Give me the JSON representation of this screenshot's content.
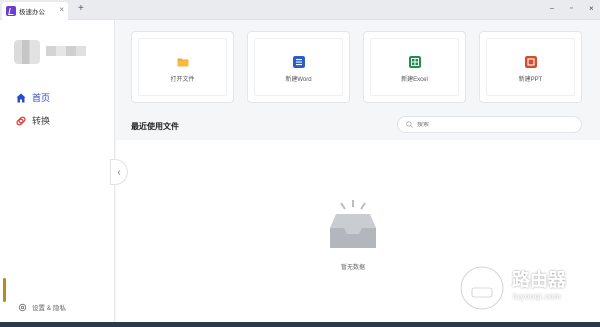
{
  "titlebar": {
    "tab_title": "极速办公",
    "tab_close": "×",
    "new_tab": "+",
    "minimize": "–",
    "maximize": "▫",
    "close": "×"
  },
  "sidebar": {
    "items": [
      {
        "label": "首页",
        "icon": "home-icon",
        "active": true
      },
      {
        "label": "转换",
        "icon": "convert-icon",
        "active": false
      }
    ],
    "settings_label": "设置 & 隐私"
  },
  "quick_actions": [
    {
      "label": "打开文件",
      "icon": "folder-icon",
      "color": "#f5a623"
    },
    {
      "label": "新建Word",
      "icon": "word-icon",
      "color": "#2b5fc7"
    },
    {
      "label": "新建Excel",
      "icon": "excel-icon",
      "color": "#1f8f4e"
    },
    {
      "label": "新建PPT",
      "icon": "ppt-icon",
      "color": "#d24d2c"
    }
  ],
  "recent": {
    "title": "最近使用文件",
    "search_placeholder": "搜索",
    "empty_text": "暂无数据"
  },
  "colors": {
    "accent": "#2b4acb",
    "brand": "#6b3fd1"
  },
  "watermark": {
    "title": "路由器",
    "subtitle": "luyouqi.com"
  }
}
